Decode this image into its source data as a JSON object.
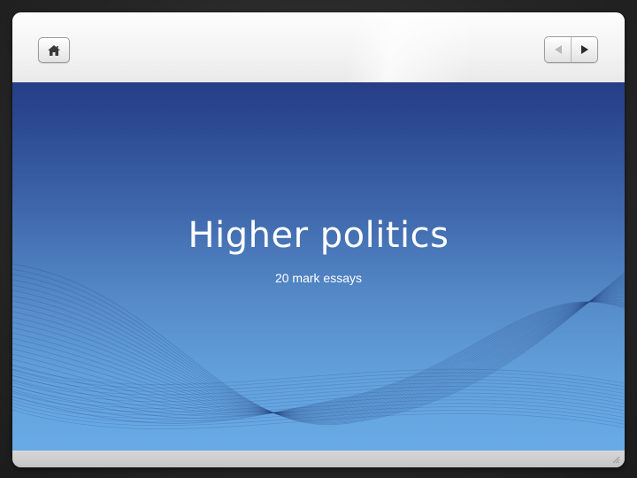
{
  "toolbar": {
    "home_icon": "home-icon",
    "prev_icon": "triangle-left-icon",
    "next_icon": "triangle-right-icon"
  },
  "slide": {
    "title": "Higher politics",
    "subtitle": "20 mark essays"
  },
  "colors": {
    "slide_top": "#263e87",
    "slide_bottom": "#69abe6",
    "text": "#ffffff"
  }
}
